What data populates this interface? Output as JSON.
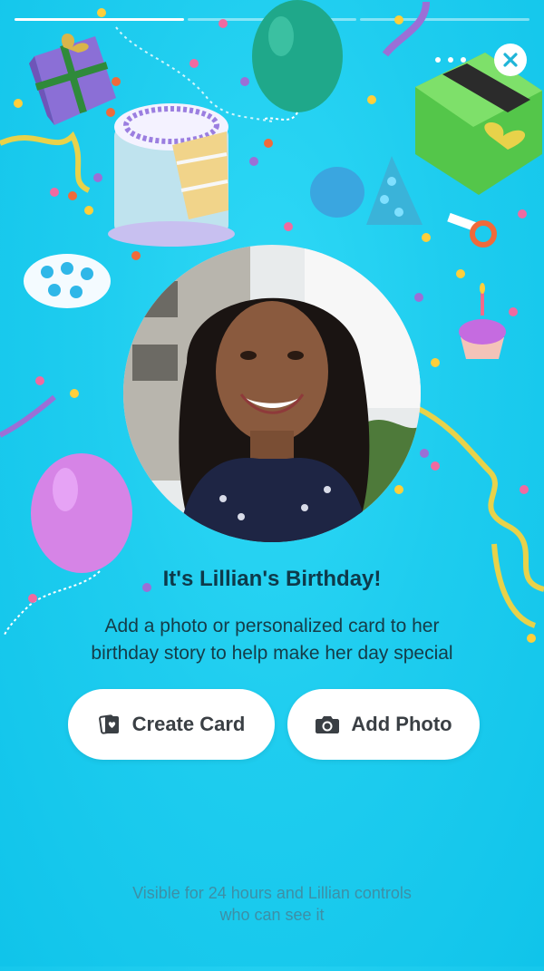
{
  "story": {
    "progress": [
      1.0,
      0.0,
      0.0
    ],
    "title": "It's Lillian's Birthday!",
    "subtitle_line1": "Add a photo or personalized card to her",
    "subtitle_line2": "birthday story to help make her day special",
    "footer_line1": "Visible for 24 hours and Lillian controls",
    "footer_line2": "who can see it"
  },
  "actions": {
    "create_card_label": "Create Card",
    "add_photo_label": "Add Photo",
    "create_card_icon": "card-heart-icon",
    "add_photo_icon": "camera-icon"
  },
  "controls": {
    "more_icon": "more-options-icon",
    "close_icon": "close-icon"
  },
  "colors": {
    "background": "#1fcdef",
    "title_text": "#0e3a4a",
    "button_bg": "#ffffff",
    "button_text": "#3a3f44",
    "footer_text": "#3d8fa6"
  }
}
